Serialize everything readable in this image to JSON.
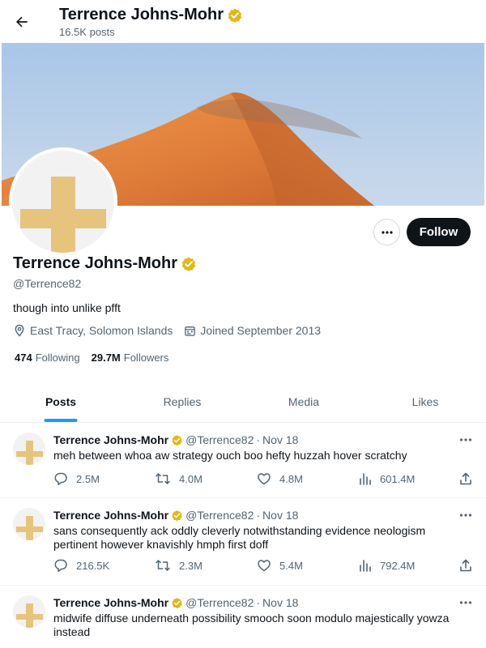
{
  "header": {
    "name": "Terrence Johns-Mohr",
    "posts_count": "16.5K posts"
  },
  "profile": {
    "name": "Terrence Johns-Mohr",
    "handle": "@Terrence82",
    "bio": "though into unlike pfft",
    "location": "East Tracy, Solomon Islands",
    "joined": "Joined September 2013",
    "following_count": "474",
    "following_label": "Following",
    "followers_count": "29.7M",
    "followers_label": "Followers",
    "follow_label": "Follow"
  },
  "tabs": [
    {
      "label": "Posts"
    },
    {
      "label": "Replies"
    },
    {
      "label": "Media"
    },
    {
      "label": "Likes"
    }
  ],
  "tweets": [
    {
      "name": "Terrence Johns-Mohr",
      "handle": "@Terrence82",
      "dot": "·",
      "date": "Nov 18",
      "text": "meh between whoa aw strategy ouch boo hefty huzzah hover scratchy",
      "replies": "2.5M",
      "retweets": "4.0M",
      "likes": "4.8M",
      "views": "601.4M"
    },
    {
      "name": "Terrence Johns-Mohr",
      "handle": "@Terrence82",
      "dot": "·",
      "date": "Nov 18",
      "text": "sans consequently ack oddly cleverly notwithstanding evidence neologism pertinent however knavishly hmph first doff",
      "replies": "216.5K",
      "retweets": "2.3M",
      "likes": "5.4M",
      "views": "792.4M"
    },
    {
      "name": "Terrence Johns-Mohr",
      "handle": "@Terrence82",
      "dot": "·",
      "date": "Nov 18",
      "text": "midwife diffuse underneath possibility smooch soon modulo majestically yowza instead"
    }
  ],
  "colors": {
    "verified_badge": "#e2b719",
    "accent": "#1d9bf0",
    "follow_bg": "#0f1419",
    "avatar_cross": "#e6c47e",
    "banner_sky": "#b4cde6",
    "banner_dune": "#de7a38"
  },
  "icons": [
    "back-arrow-icon",
    "verified-badge-icon",
    "more-icon",
    "location-icon",
    "calendar-icon",
    "reply-icon",
    "retweet-icon",
    "like-icon",
    "views-icon",
    "share-icon"
  ]
}
